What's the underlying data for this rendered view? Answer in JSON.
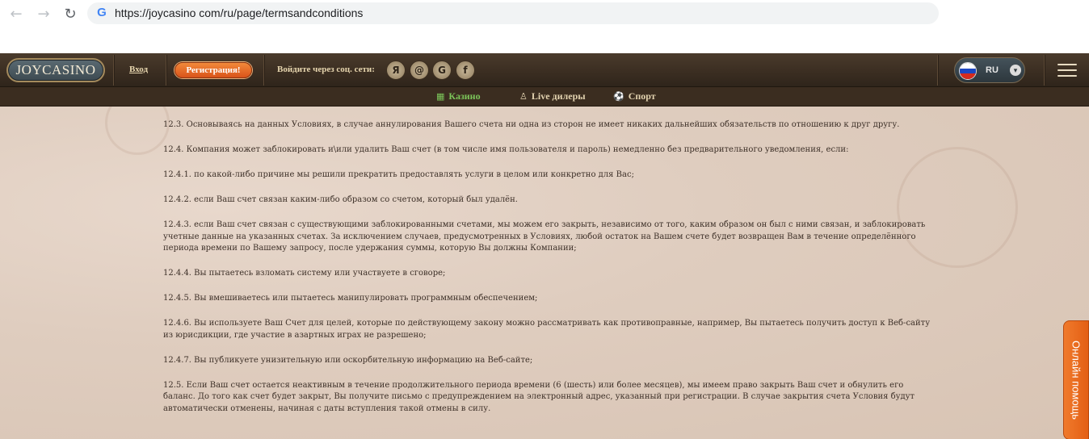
{
  "browser": {
    "url": "https://joycasino com/ru/page/termsandconditions",
    "back_icon": "←",
    "forward_icon": "→",
    "reload_icon": "↻",
    "google_icon": "G"
  },
  "header": {
    "logo": "JOYCASINO",
    "login_label": "Вход",
    "register_label": "Регистрация!",
    "social_label": "Войдите через соц. сети:",
    "social_icons": [
      "Я",
      "@",
      "G",
      "f"
    ],
    "language": "RU",
    "language_caret": "▾"
  },
  "subnav": {
    "items": [
      {
        "icon": "▦",
        "label": "Казино"
      },
      {
        "icon": "♙",
        "label": "Live дилеры"
      },
      {
        "icon": "⚽",
        "label": "Спорт"
      }
    ]
  },
  "terms": {
    "paragraphs": [
      "12.3. Основываясь на данных Условиях, в случае аннулирования Вашего счета ни одна из сторон не имеет никаких дальнейших обязательств по отношению к друг другу.",
      "12.4. Компания может заблокировать и\\или удалить Ваш счет (в том числе имя пользователя и пароль) немедленно без предварительного уведомления, если:",
      "12.4.1. по какой-либо причине мы решили прекратить предоставлять услуги в целом или конкретно для Вас;",
      "12.4.2. если Ваш счет связан каким-либо образом со счетом, который был удалён.",
      "12.4.3. если Ваш счет связан с существующими заблокированными счетами, мы можем его закрыть, независимо от того, каким образом он был с ними связан, и заблокировать учетные данные на указанных счетах. За исключением случаев, предусмотренных в Условиях, любой остаток на Вашем счете будет возвращен Вам в течение определённого периода времени по Вашему запросу, после удержания суммы, которую Вы должны Компании;",
      "12.4.4. Вы пытаетесь взломать систему или участвуете в сговоре;",
      "12.4.5. Вы вмешиваетесь или пытаетесь манипулировать программным обеспечением;",
      "12.4.6. Вы используете Ваш Счет для целей, которые по действующему закону можно рассматривать как противоправные, например, Вы пытаетесь получить доступ к Веб-сайту из юрисдикции, где участие в азартных играх не разрешено;",
      "12.4.7. Вы публикуете унизительную или оскорбительную информацию на Веб-сайте;",
      "12.5. Если Ваш счет остается неактивным в течение продолжительного периода времени (6 (шесть) или более месяцев), мы имеем право закрыть Ваш счет и обнулить его баланс. До того как счет будет закрыт, Вы получите письмо с предупреждением на электронный адрес, указанный при регистрации. В случае закрытия счета Условия будут автоматически отменены, начиная с даты вступления такой отмены в силу."
    ]
  },
  "help_tab": {
    "label": "Онлайн помощь"
  },
  "colors": {
    "active_tab": "#7cc65a",
    "register_button": "#e35f14",
    "header_bg": "#3a2d21",
    "content_bg": "#dfcdbf"
  }
}
